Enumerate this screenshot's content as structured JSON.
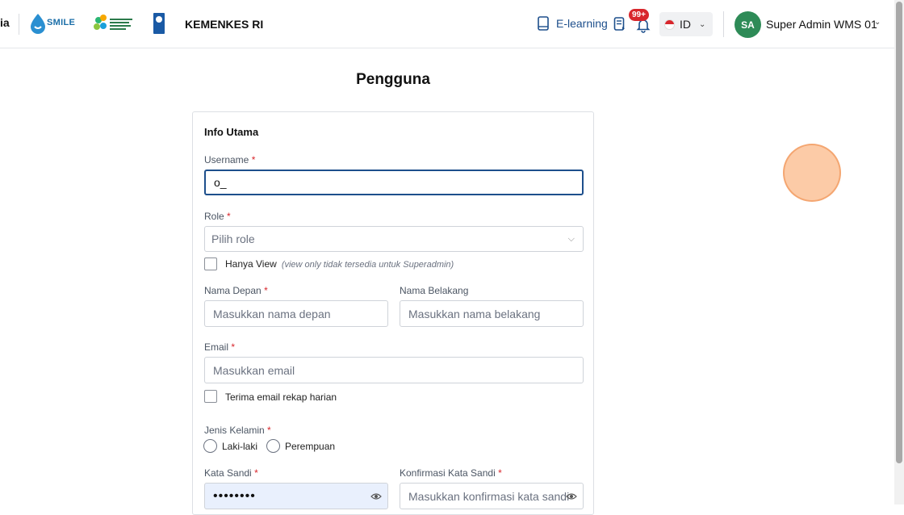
{
  "header": {
    "brand_cut": "ia",
    "smile_logo_text": "SMILE",
    "org_name": "KEMENKES RI",
    "elearning_label": "E-learning",
    "notification_count": "99+",
    "language": "ID",
    "avatar_initials": "SA",
    "user_name": "Super Admin WMS 01"
  },
  "page": {
    "title": "Pengguna"
  },
  "form": {
    "section_title": "Info Utama",
    "username_label": "Username",
    "username_value": "o_",
    "role_label": "Role",
    "role_placeholder": "Pilih role",
    "view_only_label": "Hanya View",
    "view_only_note": "(view only tidak tersedia untuk Superadmin)",
    "first_name_label": "Nama Depan",
    "first_name_placeholder": "Masukkan nama depan",
    "last_name_label": "Nama Belakang",
    "last_name_placeholder": "Masukkan nama belakang",
    "email_label": "Email",
    "email_placeholder": "Masukkan email",
    "daily_recap_label": "Terima email rekap harian",
    "gender_label": "Jenis Kelamin",
    "gender_male": "Laki-laki",
    "gender_female": "Perempuan",
    "password_label": "Kata Sandi",
    "password_value": "••••••••",
    "confirm_password_label": "Konfirmasi Kata Sandi",
    "confirm_password_placeholder": "Masukkan konfirmasi kata sandi",
    "required_mark": "*"
  },
  "colors": {
    "primary": "#1d4f8c",
    "required": "#d8262c",
    "avatar": "#2e8b57",
    "password_fill": "#e9f0fd"
  }
}
